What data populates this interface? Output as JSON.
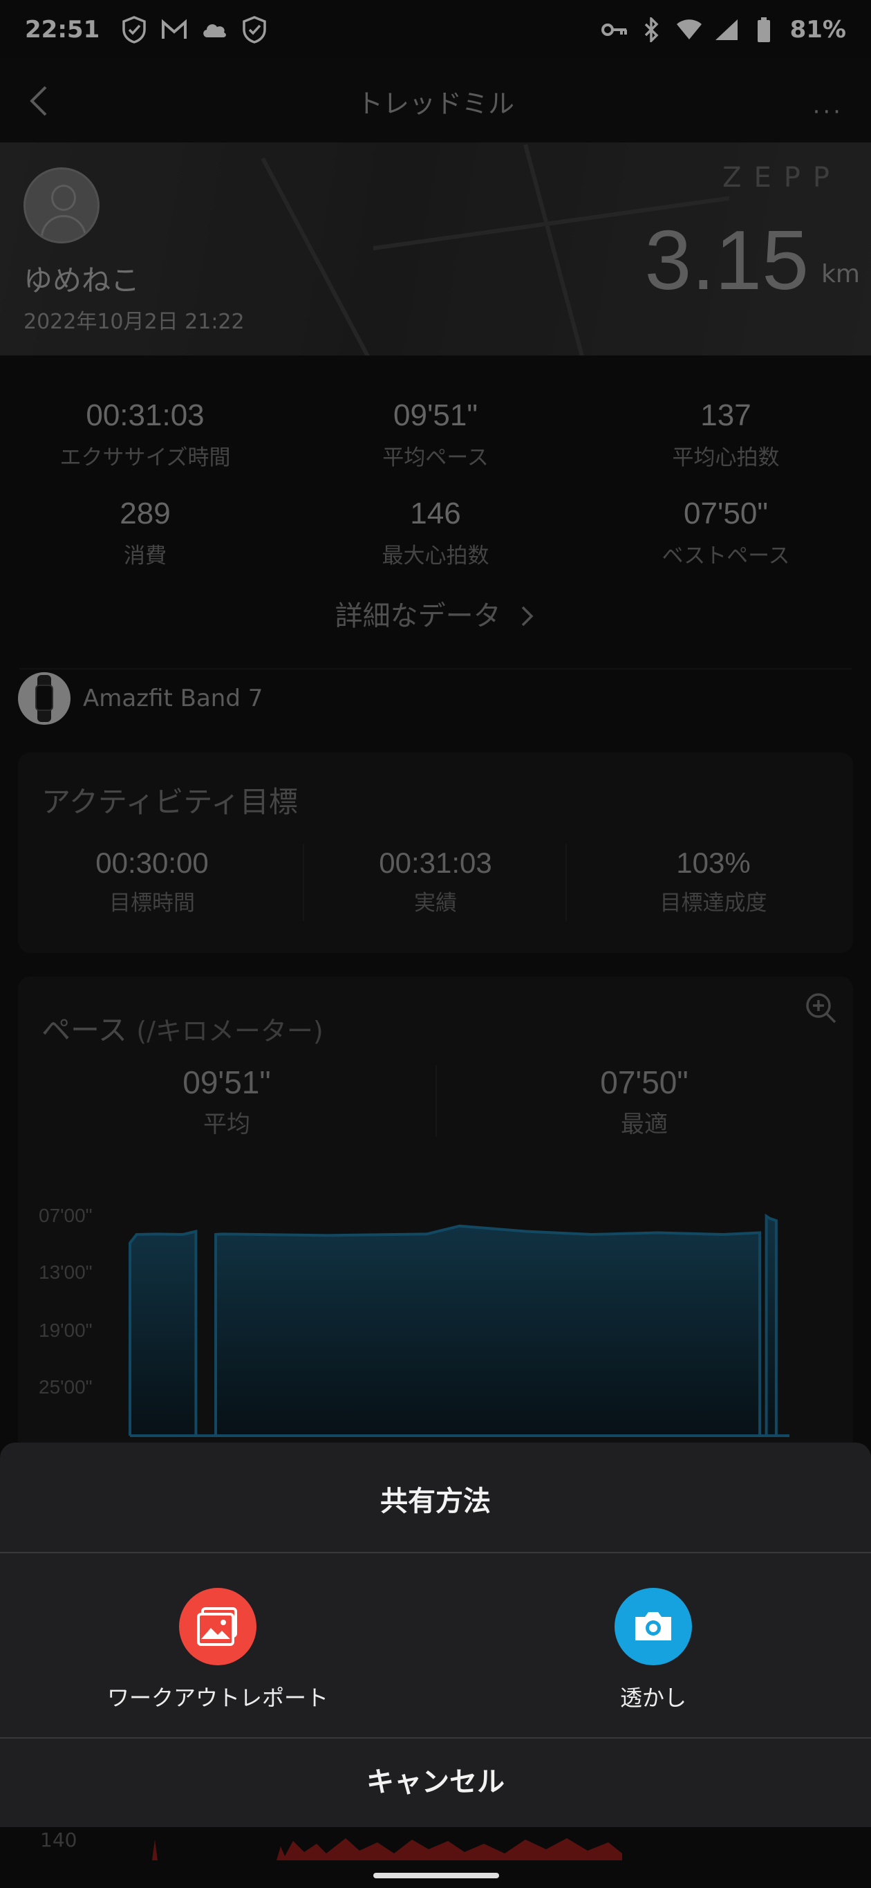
{
  "status_bar": {
    "time": "22:51",
    "battery": "81%"
  },
  "header": {
    "title": "トレッドミル",
    "more": "···"
  },
  "banner": {
    "username": "ゆめねこ",
    "datetime": "2022年10月2日 21:22",
    "brand": "ZEPP",
    "distance": "3.15",
    "unit": "km"
  },
  "stats": [
    {
      "value": "00:31:03",
      "label": "エクササイズ時間"
    },
    {
      "value": "09'51\"",
      "label": "平均ペース"
    },
    {
      "value": "137",
      "label": "平均心拍数"
    },
    {
      "value": "289",
      "label": "消費"
    },
    {
      "value": "146",
      "label": "最大心拍数"
    },
    {
      "value": "07'50\"",
      "label": "ベストペース"
    }
  ],
  "more_data_link": "詳細なデータ",
  "device": {
    "name": "Amazfit Band 7"
  },
  "goal_card": {
    "title": "アクティビティ目標",
    "items": [
      {
        "value": "00:30:00",
        "label": "目標時間"
      },
      {
        "value": "00:31:03",
        "label": "実績"
      },
      {
        "value": "103%",
        "label": "目標達成度"
      }
    ]
  },
  "pace_card": {
    "title": "ペース",
    "title_unit": "(/キロメーター)",
    "summary": [
      {
        "value": "09'51\"",
        "label": "平均"
      },
      {
        "value": "07'50\"",
        "label": "最適"
      }
    ]
  },
  "chart_data": {
    "type": "area",
    "title": "ペース (/キロメーター)",
    "y_tick_labels": [
      "07'00\"",
      "13'00\"",
      "19'00\"",
      "25'00\""
    ],
    "y_inverted": true,
    "grid": false,
    "color": "#1d6f95",
    "segments": [
      {
        "x": [
          0.0,
          0.01,
          0.04,
          0.08,
          0.1
        ],
        "y": [
          430,
          449,
          450,
          449,
          456
        ]
      },
      {
        "x": [
          0.13,
          0.14,
          0.3,
          0.45,
          0.5,
          0.6,
          0.7,
          0.8,
          0.9,
          0.955
        ],
        "y": [
          449,
          450,
          447,
          450,
          468,
          456,
          449,
          453,
          449,
          453
        ]
      },
      {
        "x": [
          0.965,
          0.97,
          0.98
        ],
        "y": [
          490,
          485,
          480
        ]
      }
    ]
  },
  "heart_rate_axis": {
    "label": "140"
  },
  "share_sheet": {
    "title": "共有方法",
    "options": [
      {
        "label": "ワークアウトレポート",
        "icon": "image-icon",
        "color": "#f0453a"
      },
      {
        "label": "透かし",
        "icon": "camera-icon",
        "color": "#16a2df"
      }
    ],
    "cancel": "キャンセル"
  }
}
